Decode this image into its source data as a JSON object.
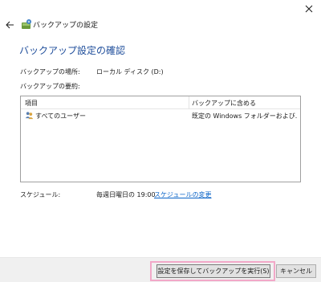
{
  "window": {
    "title": "バックアップの設定"
  },
  "page": {
    "heading": "バックアップ設定の確認",
    "location_label": "バックアップの場所:",
    "location_value": "ローカル ディスク (D:)",
    "summary_label": "バックアップの要約:"
  },
  "list": {
    "columns": [
      "項目",
      "バックアップに含める"
    ],
    "rows": [
      {
        "item": "すべてのユーザー",
        "included": "既定の Windows フォルダーおよび..."
      }
    ]
  },
  "schedule": {
    "label": "スケジュール:",
    "value": "毎週日曜日の 19:00",
    "change_link": "スケジュールの変更"
  },
  "buttons": {
    "save_and_run": "設定を保存してバックアップを実行(S)",
    "cancel": "キャンセル"
  },
  "colors": {
    "heading": "#1f4e9b",
    "link": "#0a64c8",
    "focus_outline": "#f2a8c8"
  },
  "icons": {
    "close": "close-icon",
    "back": "back-arrow-icon",
    "app": "backup-icon",
    "users": "users-icon"
  }
}
